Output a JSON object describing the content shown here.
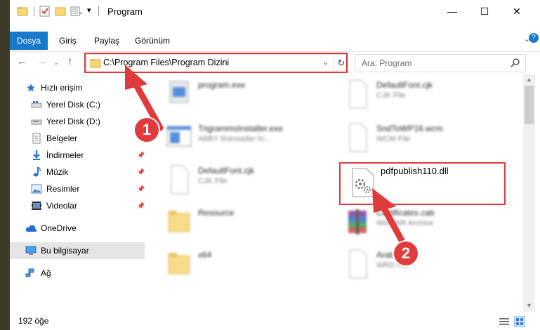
{
  "window": {
    "title": "Program",
    "buttons": {
      "minimize": "—",
      "maximize": "☐",
      "close": "✕"
    }
  },
  "ribbon": {
    "file_tab": "Dosya",
    "tabs": [
      "Giriş",
      "Paylaş",
      "Görünüm"
    ],
    "help": "?"
  },
  "address": {
    "path": "C:\\Program Files\\Program Dizini"
  },
  "search": {
    "placeholder": "Ara: Program"
  },
  "sidebar": {
    "items": [
      {
        "label": "Hızlı erişim",
        "icon": "star-icon"
      },
      {
        "label": "Yerel Disk (C:)",
        "icon": "drive-icon"
      },
      {
        "label": "Yerel Disk (D:)",
        "icon": "drive-icon"
      },
      {
        "label": "Belgeler",
        "icon": "documents-icon"
      },
      {
        "label": "İndirmeler",
        "icon": "download-icon"
      },
      {
        "label": "Müzik",
        "icon": "music-icon"
      },
      {
        "label": "Resimler",
        "icon": "pictures-icon"
      },
      {
        "label": "Videolar",
        "icon": "videos-icon"
      },
      {
        "label": "OneDrive",
        "icon": "cloud-icon"
      },
      {
        "label": "Bu bilgisayar",
        "icon": "computer-icon"
      },
      {
        "label": "Ağ",
        "icon": "network-icon"
      }
    ]
  },
  "files": [
    {
      "name": "program.exe",
      "sub": ""
    },
    {
      "name": "DefaultFont.cjk",
      "sub": "CJK File"
    },
    {
      "name": "TrigrammsInstaller.exe",
      "sub": "ABBY finereader tri..."
    },
    {
      "name": "SndToWP16.wcm",
      "sub": "WCM File"
    },
    {
      "name": "DefaultFont.cjk",
      "sub": "CJK File"
    },
    {
      "name": "pdfpublish110.dll",
      "sub": ""
    },
    {
      "name": "Resource",
      "sub": ""
    },
    {
      "name": "Certificates.cab",
      "sub": "WinRAR Archive"
    },
    {
      "name": "x64",
      "sub": ""
    },
    {
      "name": "Arabic",
      "sub": "WRD File"
    }
  ],
  "status": {
    "count": "192 öğe"
  },
  "annotations": {
    "badge1": "1",
    "badge2": "2"
  },
  "colors": {
    "accent": "#1979ca",
    "highlight": "#e03a3a"
  }
}
